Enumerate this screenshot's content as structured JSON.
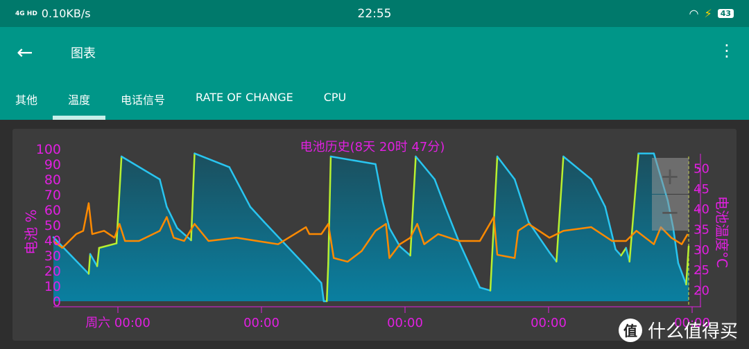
{
  "status": {
    "network": "4G HD",
    "speed": "0.10KB/s",
    "time": "22:55",
    "battery": "43"
  },
  "appbar": {
    "title": "图表",
    "back_icon": "arrow-left-icon",
    "menu_icon": "more-vert-icon"
  },
  "tabs": [
    {
      "label": "其他"
    },
    {
      "label": "温度",
      "active": true
    },
    {
      "label": "电话信号"
    },
    {
      "label": "RATE OF CHANGE"
    },
    {
      "label": "CPU"
    }
  ],
  "zoom": {
    "plus": "+",
    "minus": "−"
  },
  "watermark": {
    "logo": "值",
    "text": "什么值得买"
  },
  "colors": {
    "accent": "#009688",
    "status": "#00796b",
    "axis": "#e020e0",
    "battery_discharge": "#29c5f0",
    "battery_charge": "#b8f030",
    "temperature": "#ff8a00"
  },
  "chart_data": {
    "type": "line",
    "title": "电池历史(8天 20时 47分)",
    "ylabel": "电池 %",
    "ylim": [
      0,
      100
    ],
    "yticks": [
      0,
      10,
      20,
      30,
      40,
      50,
      60,
      70,
      80,
      90,
      100
    ],
    "y2label": "电池温度°C",
    "y2lim": [
      16,
      53
    ],
    "y2ticks": [
      20,
      25,
      30,
      35,
      40,
      45,
      50
    ],
    "xlim": [
      "周五 13:10",
      "周二 23:40"
    ],
    "xticks": [
      {
        "t": "周六 00:00",
        "label": "周六 00:00"
      },
      {
        "t": "周日 00:00",
        "label": "00:00"
      },
      {
        "t": "周一 00:00",
        "label": "00:00"
      },
      {
        "t": "周二 00:00",
        "label": "00:00"
      },
      {
        "t": "周三 00:00",
        "label": "00:00"
      }
    ],
    "series": [
      {
        "axis": "left",
        "points": [
          [
            "周五 13:10",
            42
          ],
          [
            "周五 19:05",
            18
          ],
          [
            "周五 19:20",
            31
          ],
          [
            "周五 20:30",
            23
          ],
          [
            "周五 20:50",
            35
          ],
          [
            "周五 23:45",
            38
          ],
          [
            "周六 00:35",
            95
          ],
          [
            "周六 07:00",
            80
          ],
          [
            "周六 08:10",
            62
          ],
          [
            "周六 09:55",
            48
          ],
          [
            "周六 12:15",
            40
          ],
          [
            "周六 12:50",
            97
          ],
          [
            "周六 18:40",
            88
          ],
          [
            "周六 22:10",
            62
          ],
          [
            "周日 00:30",
            52
          ],
          [
            "周日 07:30",
            23
          ],
          [
            "周日 10:05",
            12
          ],
          [
            "周日 10:30",
            0
          ],
          [
            "周日 11:00",
            0
          ],
          [
            "周日 11:15",
            25
          ],
          [
            "周日 11:40",
            95
          ],
          [
            "周日 19:10",
            90
          ],
          [
            "周日 20:20",
            66
          ],
          [
            "周日 21:30",
            48
          ],
          [
            "周日 23:15",
            36
          ],
          [
            "周一 01:00",
            30
          ],
          [
            "周一 01:55",
            95
          ],
          [
            "周一 05:05",
            80
          ],
          [
            "周一 06:50",
            62
          ],
          [
            "周一 09:10",
            39
          ],
          [
            "周一 12:40",
            9
          ],
          [
            "周一 14:25",
            7
          ],
          [
            "周一 15:35",
            95
          ],
          [
            "周一 18:30",
            80
          ],
          [
            "周一 20:50",
            52
          ],
          [
            "周二 00:20",
            32
          ],
          [
            "周二 01:30",
            26
          ],
          [
            "周二 02:40",
            95
          ],
          [
            "周二 07:20",
            80
          ],
          [
            "周二 09:40",
            62
          ],
          [
            "周二 11:25",
            34
          ],
          [
            "周二 12:20",
            30
          ],
          [
            "周二 13:10",
            35
          ],
          [
            "周二 13:45",
            26
          ],
          [
            "周二 15:15",
            97
          ],
          [
            "周二 17:50",
            97
          ],
          [
            "周二 20:10",
            66
          ],
          [
            "周二 21:05",
            48
          ],
          [
            "周二 21:55",
            25
          ],
          [
            "周二 23:15",
            11
          ],
          [
            "周二 23:40",
            36
          ]
        ]
      },
      {
        "axis": "right",
        "points": [
          [
            "周五 13:10",
            32.2
          ],
          [
            "周五 14:40",
            30.5
          ],
          [
            "周五 17:00",
            33.9
          ],
          [
            "周五 18:10",
            34.7
          ],
          [
            "周五 19:05",
            41.5
          ],
          [
            "周五 19:40",
            33.9
          ],
          [
            "周五 21:40",
            34.7
          ],
          [
            "周五 23:25",
            33
          ],
          [
            "周六 00:15",
            36.4
          ],
          [
            "周六 01:10",
            32.2
          ],
          [
            "周六 03:30",
            32.2
          ],
          [
            "周六 07:00",
            34.7
          ],
          [
            "周六 08:10",
            38.1
          ],
          [
            "周六 09:20",
            33
          ],
          [
            "周六 11:05",
            32.2
          ],
          [
            "周六 12:50",
            36.4
          ],
          [
            "周六 15:10",
            32.2
          ],
          [
            "周六 19:50",
            33
          ],
          [
            "周六 23:20",
            32.2
          ],
          [
            "周日 02:50",
            31.4
          ],
          [
            "周日 07:30",
            35.6
          ],
          [
            "周日 08:05",
            33.9
          ],
          [
            "周日 10:05",
            33.9
          ],
          [
            "周日 11:15",
            36.4
          ],
          [
            "周日 12:10",
            28
          ],
          [
            "周日 14:30",
            27.1
          ],
          [
            "周日 16:50",
            29.7
          ],
          [
            "周日 19:10",
            34.7
          ],
          [
            "周日 20:55",
            36.4
          ],
          [
            "周日 21:30",
            28
          ],
          [
            "周日 23:15",
            31.4
          ],
          [
            "周一 01:00",
            33
          ],
          [
            "周一 02:10",
            36.4
          ],
          [
            "周一 03:20",
            31.4
          ],
          [
            "周一 05:40",
            33.9
          ],
          [
            "周一 09:10",
            32.2
          ],
          [
            "周一 12:40",
            32.2
          ],
          [
            "周一 15:00",
            38.1
          ],
          [
            "周一 15:35",
            28.8
          ],
          [
            "周一 18:30",
            28
          ],
          [
            "周一 19:05",
            34.7
          ],
          [
            "周一 20:50",
            36.4
          ],
          [
            "周二 00:20",
            33
          ],
          [
            "周二 02:40",
            34.7
          ],
          [
            "周二 07:20",
            35.6
          ],
          [
            "周二 10:50",
            32.2
          ],
          [
            "周二 13:10",
            32.2
          ],
          [
            "周二 14:55",
            34.7
          ],
          [
            "周二 17:50",
            31.4
          ],
          [
            "周二 19:00",
            35.6
          ],
          [
            "周二 20:45",
            33
          ],
          [
            "周二 22:30",
            31.4
          ],
          [
            "周二 23:30",
            33.9
          ]
        ]
      }
    ]
  }
}
